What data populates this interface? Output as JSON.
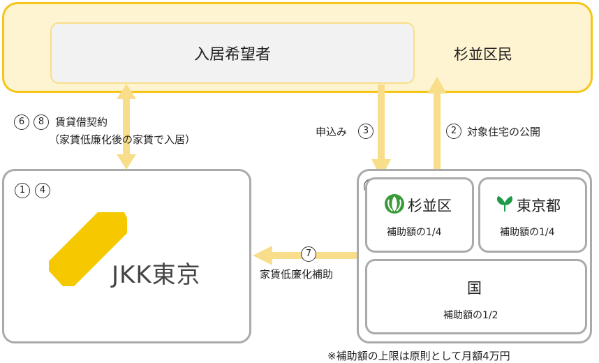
{
  "resident": {
    "label": "杉並区民"
  },
  "applicant": {
    "label": "入居希望者"
  },
  "edges": {
    "lease": {
      "nums": [
        "6",
        "8"
      ],
      "line1": "賃貸借契約",
      "line2": "（家賃低廉化後の家賃で入居）"
    },
    "apply": {
      "label": "申込み",
      "num": "3"
    },
    "publish": {
      "num": "2",
      "label": "対象住宅の公開"
    },
    "subsidy": {
      "num": "7",
      "label": "家賃低廉化補助"
    }
  },
  "jkk": {
    "nums": [
      "1",
      "4"
    ],
    "logo_text": "JKK東京"
  },
  "gov": {
    "num": "5",
    "suginami": {
      "name": "杉並区",
      "share": "補助額の1/4"
    },
    "tokyo": {
      "name": "東京都",
      "share": "補助額の1/4"
    },
    "national": {
      "name": "国",
      "share": "補助額の1/2"
    }
  },
  "footnote": "※補助額の上限は原則として月額4万円",
  "colors": {
    "accent_yellow": "#f5c518",
    "arrow_yellow": "#f8de8a",
    "resident_bg": "#fff4d1",
    "box_border": "#aaaaaa",
    "suginami_green": "#3a9a3a",
    "tokyo_green": "#1e9a4a",
    "jkk_yellow": "#f5c800"
  }
}
